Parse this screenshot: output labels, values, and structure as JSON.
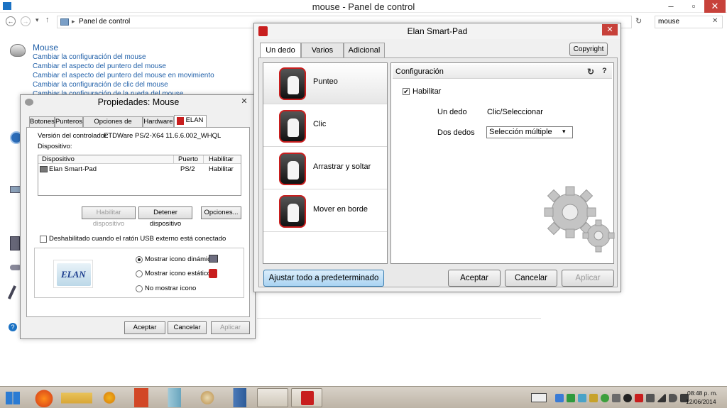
{
  "control_panel": {
    "window_title": "mouse - Panel de control",
    "breadcrumb": "Panel de control",
    "search_value": "mouse",
    "heading": "Mouse",
    "links": [
      "Cambiar la configuración del mouse",
      "Cambiar el aspecto del puntero del mouse",
      "Cambiar el aspecto del puntero del mouse en movimiento",
      "Cambiar la configuración de clic del mouse",
      "Cambiar la configuración de la rueda del mouse"
    ],
    "help_glyph": "?"
  },
  "elan_dialog": {
    "title": "Elan Smart-Pad",
    "tabs": [
      "Un dedo",
      "Varios dedos",
      "Adicional"
    ],
    "copyright_label": "Copyright",
    "gestures": [
      "Punteo",
      "Clic",
      "Arrastrar y soltar",
      "Mover en borde"
    ],
    "config_title": "Configuración",
    "enable_label": "Habilitar",
    "enabled": true,
    "rows": [
      {
        "label": "Un dedo",
        "value": "Clic/Seleccionar"
      },
      {
        "label": "Dos dedos",
        "value": "Selección múltiple"
      }
    ],
    "reset_label": "Ajustar todo a predeterminado",
    "ok_label": "Aceptar",
    "cancel_label": "Cancelar",
    "apply_label": "Aplicar"
  },
  "mouse_props": {
    "title": "Propiedades: Mouse",
    "tabs": [
      "Botones",
      "Punteros",
      "Opciones de puntero",
      "Hardware",
      "ELAN"
    ],
    "driver_label": "Versión del controlador:",
    "driver_value": "ETDWare PS/2-X64 11.6.6.002_WHQL",
    "device_label": "Dispositivo:",
    "columns": [
      "Dispositivo",
      "Puerto",
      "Habilitar"
    ],
    "device_row": {
      "name": "Elan Smart-Pad",
      "port": "PS/2",
      "status": "Habilitar"
    },
    "btn_enable": "Habilitar dispositivo",
    "btn_stop": "Detener dispositivo",
    "btn_options": "Opciones...",
    "usb_checkbox": "Deshabilitado cuando el ratón USB externo está conectado",
    "logo_text": "ELAN",
    "radio_dynamic": "Mostrar icono dinámico",
    "radio_static": "Mostrar icono estático",
    "radio_none": "No mostrar icono",
    "ok_label": "Aceptar",
    "cancel_label": "Cancelar",
    "apply_label": "Aplicar"
  },
  "taskbar": {
    "time": "08:48 p. m.",
    "date": "12/06/2014"
  },
  "colors": {
    "accent_red": "#c81e1e",
    "link_blue": "#1f5fa8",
    "highlight_blue": "#bfe0f7"
  }
}
